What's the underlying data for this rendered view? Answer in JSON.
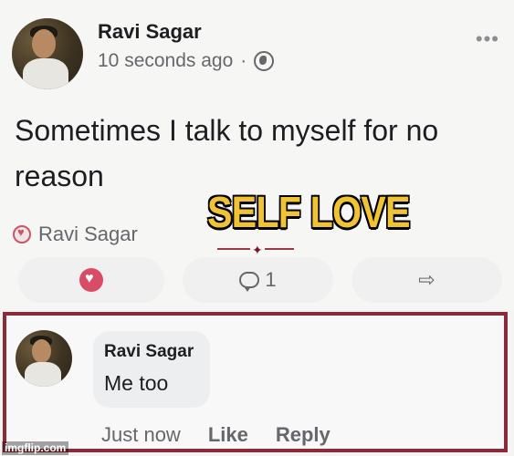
{
  "post": {
    "author": "Ravi Sagar",
    "timestamp": "10 seconds ago",
    "separator": "·",
    "privacy_icon": "globe-icon",
    "more_label": "•••",
    "text": "Sometimes I talk to myself for no reason",
    "reaction_name": "Ravi Sagar",
    "comment_count": "1"
  },
  "overlay": {
    "caption": "SELF LOVE"
  },
  "comment": {
    "author": "Ravi Sagar",
    "text": "Me too",
    "time": "Just now",
    "like_label": "Like",
    "reply_label": "Reply"
  },
  "watermark": {
    "text": "imgflip.com"
  },
  "colors": {
    "accent_heart": "#d94c65",
    "highlight_border": "#8b2a3a",
    "caption_fill": "#f1c232"
  }
}
